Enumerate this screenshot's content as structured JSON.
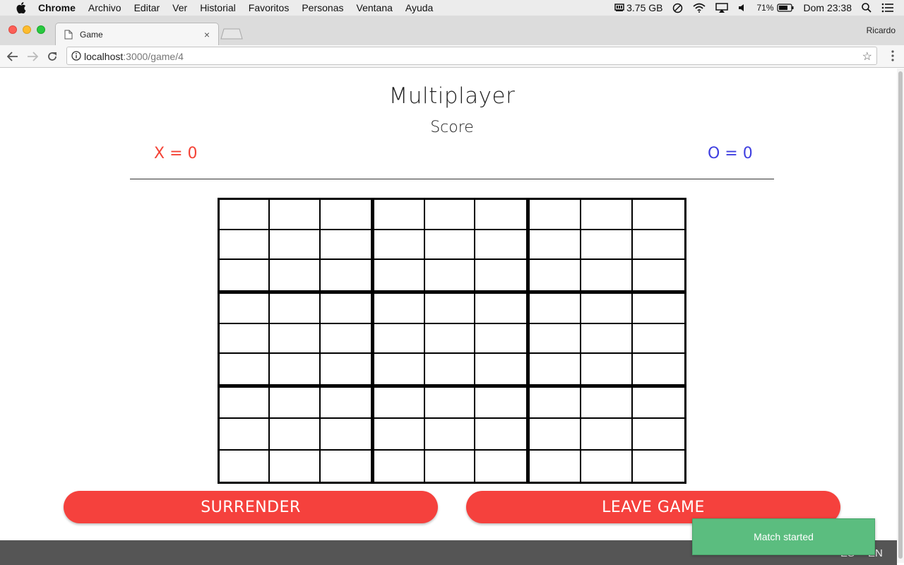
{
  "menubar": {
    "app": "Chrome",
    "items": [
      "Archivo",
      "Editar",
      "Ver",
      "Historial",
      "Favoritos",
      "Personas",
      "Ventana",
      "Ayuda"
    ],
    "memory": "3.75 GB",
    "battery": "71%",
    "clock": "Dom 23:38"
  },
  "browser": {
    "tab_title": "Game",
    "tab_close": "×",
    "profile": "Ricardo",
    "url_host": "localhost",
    "url_path": ":3000/game/4",
    "bookmark_star": "☆"
  },
  "game": {
    "title": "Multiplayer",
    "score_label": "Score",
    "score_x": "X = 0",
    "score_o": "O = 0",
    "buttons": {
      "surrender": "SURRENDER",
      "leave": "LEAVE GAME"
    }
  },
  "footer": {
    "lang_es": "ES",
    "lang_en": "EN"
  },
  "toast": {
    "message": "Match started"
  },
  "colors": {
    "x_color": "#f44336",
    "o_color": "#3f3fe0",
    "button_color": "#f5413d",
    "toast_color": "#5bbd7f"
  }
}
